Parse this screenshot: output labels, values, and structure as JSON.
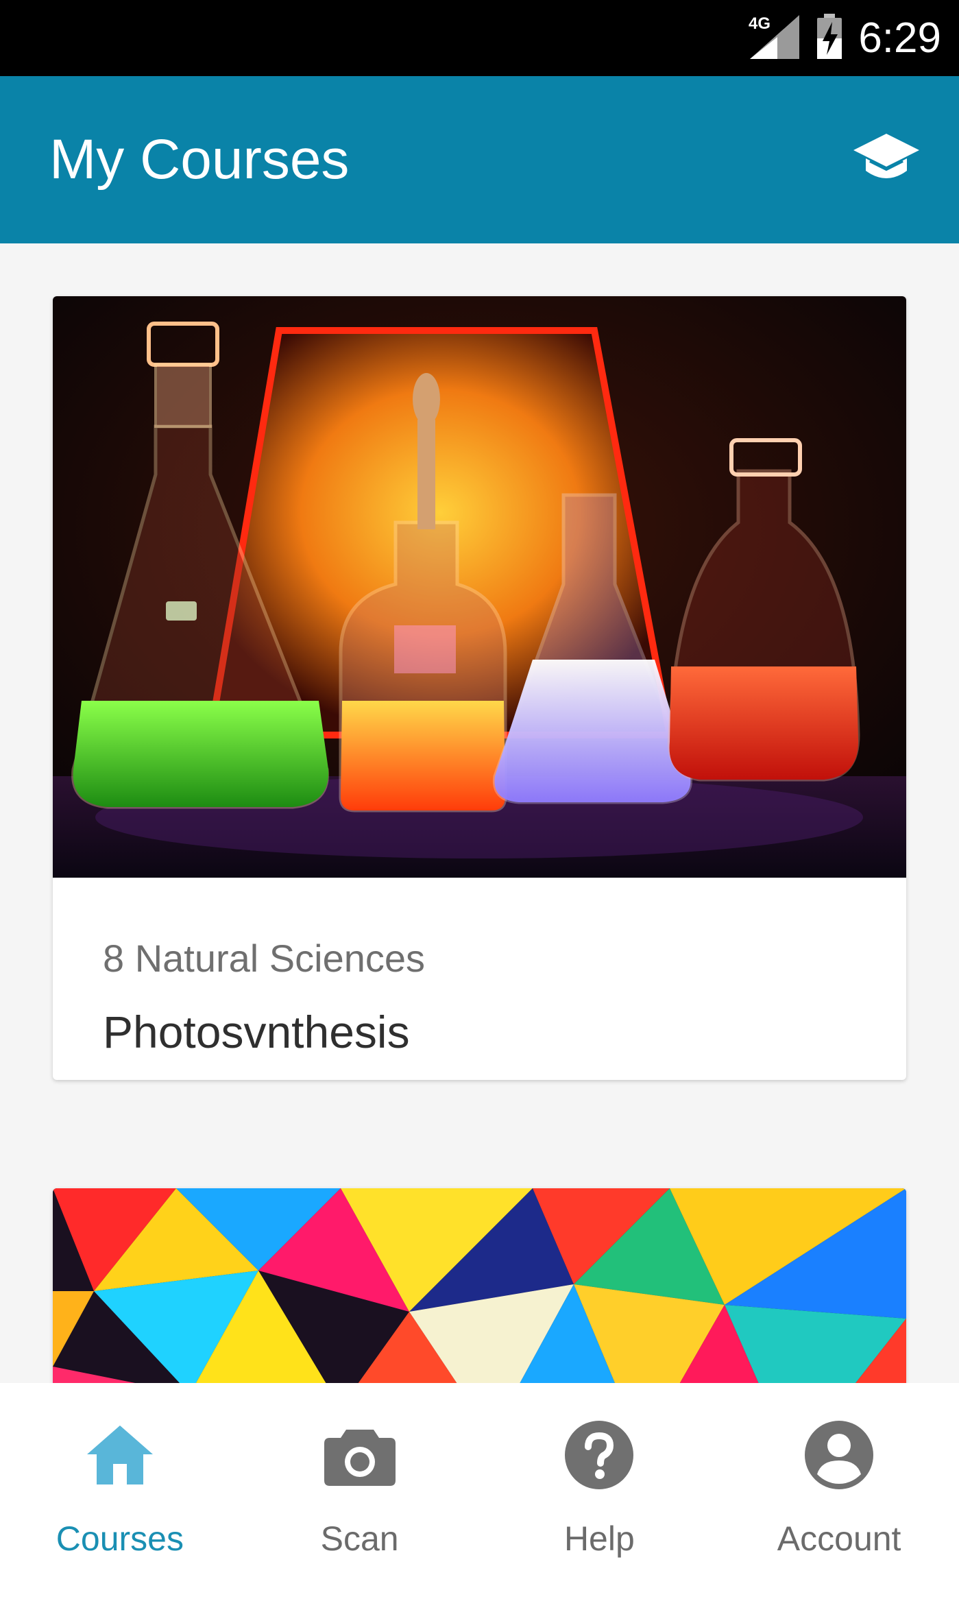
{
  "status_bar": {
    "network": "4G",
    "time": "6:29"
  },
  "app_bar": {
    "title": "My Courses",
    "action_icon": "graduation-cap-icon"
  },
  "courses": [
    {
      "subject": "8 Natural Sciences",
      "title": "Photosvnthesis",
      "image": "lab-flasks-image"
    },
    {
      "subject": "",
      "title": "",
      "image": "colorful-abstract-image"
    }
  ],
  "bottom_nav": {
    "items": [
      {
        "label": "Courses",
        "icon": "home-icon",
        "active": true
      },
      {
        "label": "Scan",
        "icon": "camera-icon",
        "active": false
      },
      {
        "label": "Help",
        "icon": "help-icon",
        "active": false
      },
      {
        "label": "Account",
        "icon": "account-icon",
        "active": false
      }
    ]
  },
  "colors": {
    "app_bar": "#0a83a8",
    "active_nav": "#1a8fb3",
    "inactive_nav": "#6b6b6b",
    "status_bar": "#000000"
  }
}
